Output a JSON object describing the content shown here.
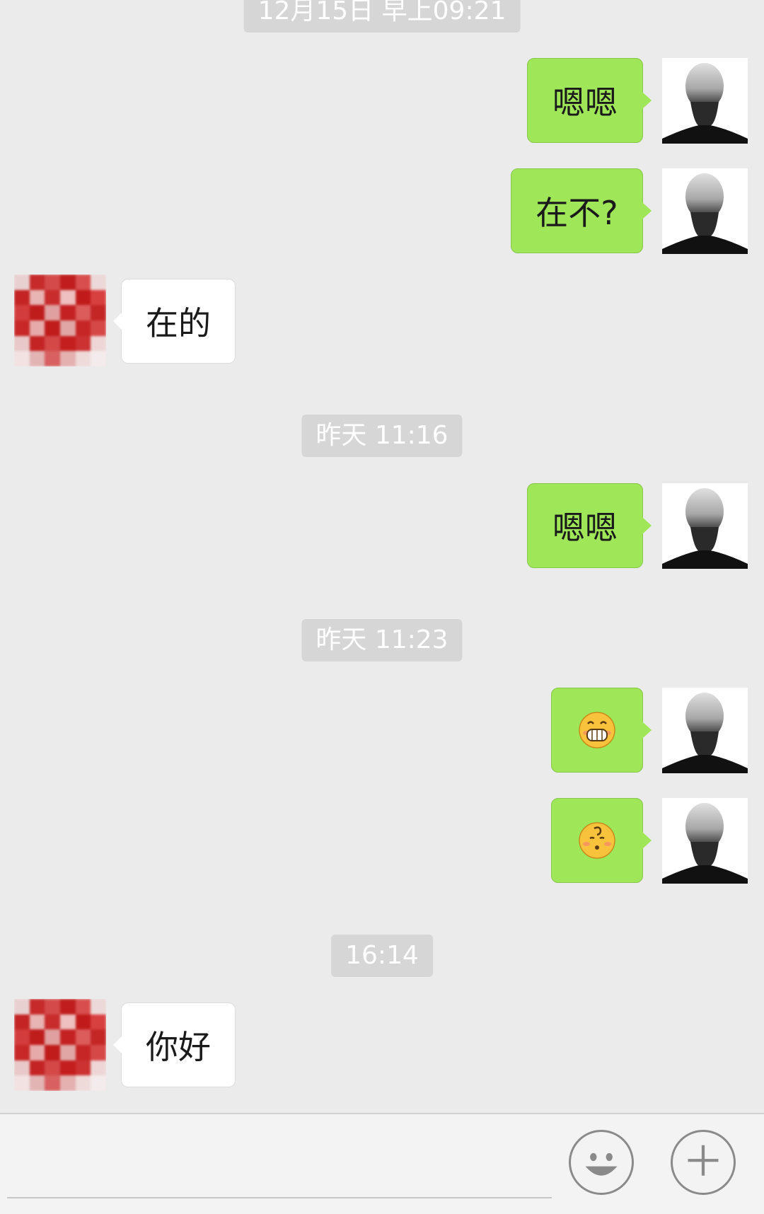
{
  "timestamps": [
    "12月15日 早上09:21",
    "昨天 11:16",
    "昨天 11:23",
    "16:14"
  ],
  "messages": [
    {
      "side": "out",
      "type": "text",
      "text": "嗯嗯"
    },
    {
      "side": "out",
      "type": "text",
      "text": "在不?"
    },
    {
      "side": "in",
      "type": "text",
      "text": "在的"
    },
    {
      "side": "out",
      "type": "text",
      "text": "嗯嗯"
    },
    {
      "side": "out",
      "type": "emoji",
      "icon": "grin-emoji-icon"
    },
    {
      "side": "out",
      "type": "emoji",
      "icon": "confused-emoji-icon"
    },
    {
      "side": "in",
      "type": "text",
      "text": "你好"
    }
  ],
  "input_bar": {
    "message_input_placeholder": "",
    "emoji_button_icon": "smiley-face-icon",
    "more_button_icon": "plus-icon"
  },
  "colors": {
    "background": "#ebebeb",
    "outgoing_bubble": "#9fe659",
    "incoming_bubble": "#ffffff",
    "timestamp_bg": "#d6d6d6"
  }
}
